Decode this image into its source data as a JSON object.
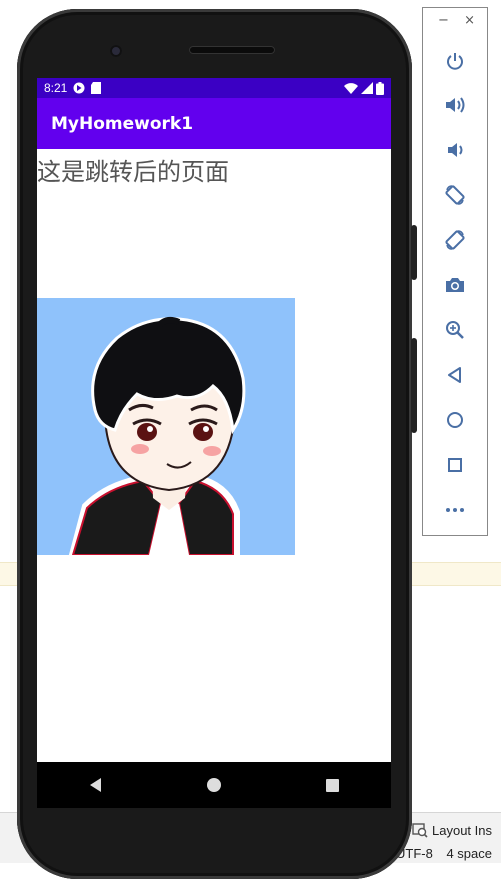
{
  "statusbar": {
    "time": "8:21"
  },
  "app": {
    "title": "MyHomework1",
    "heading": "这是跳转后的页面"
  },
  "toolbar": {
    "minimize": "−",
    "close": "×"
  },
  "ide": {
    "layout_inspector": "Layout Ins",
    "encoding": "UTF-8",
    "indent": "4 space"
  },
  "colors": {
    "status_bar": "#3b00c4",
    "app_bar": "#6200ee",
    "avatar_bg": "#8fc2fb",
    "toolbar_icons": "#4a6fa5"
  }
}
